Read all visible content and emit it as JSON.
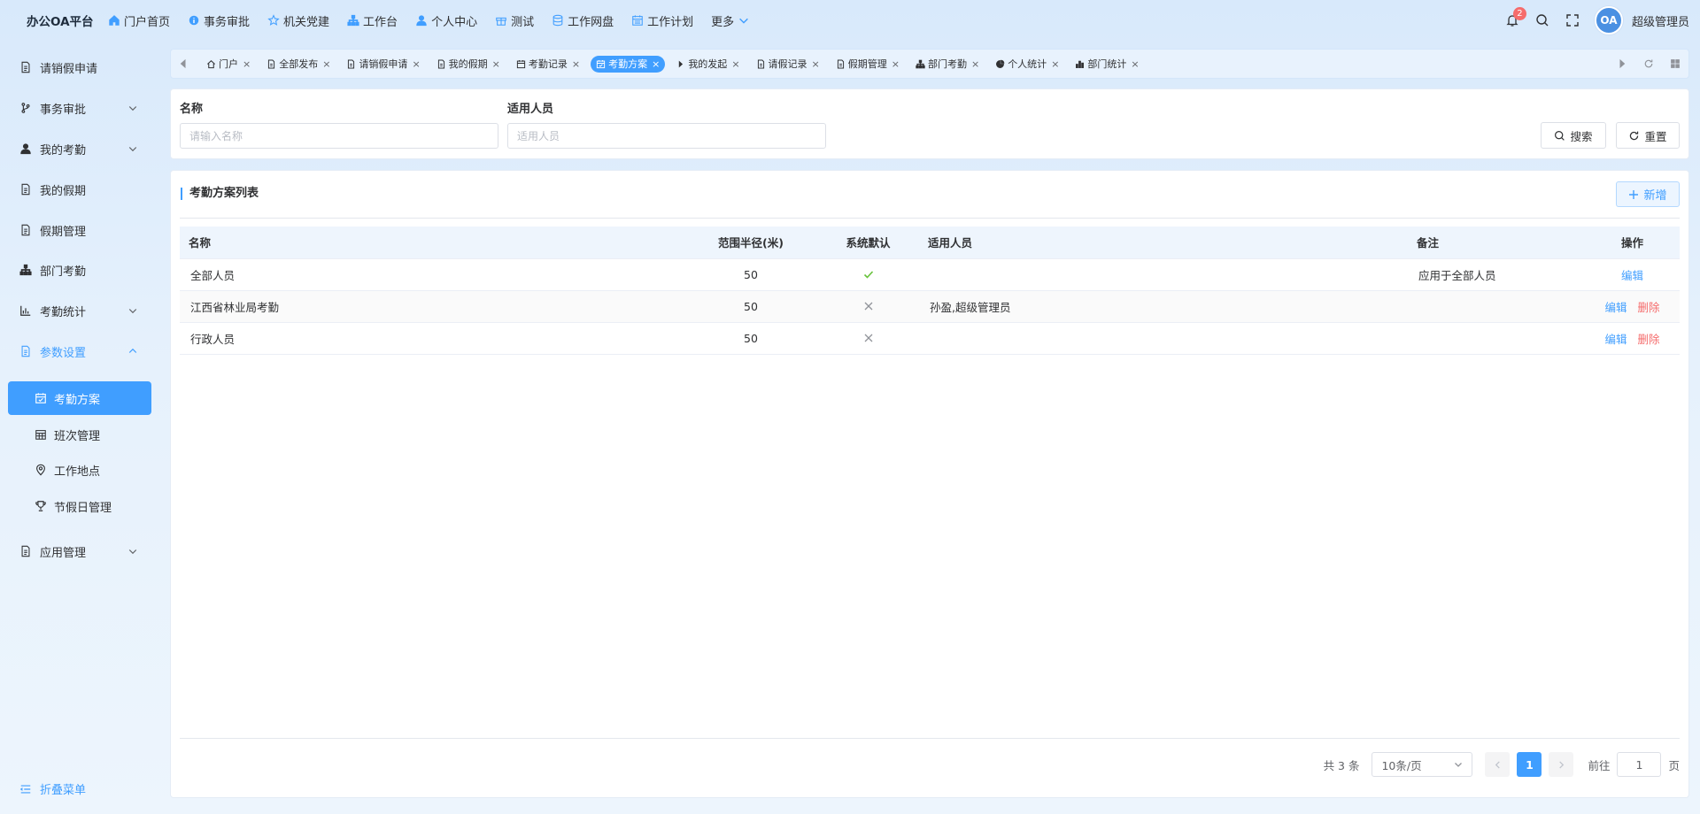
{
  "app": {
    "brand": "办公OA平台"
  },
  "topnav": [
    {
      "label": "门户首页",
      "icon": "home-icon"
    },
    {
      "label": "事务审批",
      "icon": "info-icon"
    },
    {
      "label": "机关党建",
      "icon": "star-icon"
    },
    {
      "label": "工作台",
      "icon": "org-icon"
    },
    {
      "label": "个人中心",
      "icon": "user-icon"
    },
    {
      "label": "测试",
      "icon": "gift-icon"
    },
    {
      "label": "工作网盘",
      "icon": "database-icon"
    },
    {
      "label": "工作计划",
      "icon": "calendar-icon"
    },
    {
      "label": "更多",
      "icon": "chevron-down-icon"
    }
  ],
  "header": {
    "notifications": "2",
    "avatar_text": "OA",
    "username": "超级管理员"
  },
  "sidebar": {
    "items": [
      {
        "label": "请销假申请",
        "icon": "document-icon"
      },
      {
        "label": "事务审批",
        "icon": "branch-icon"
      },
      {
        "label": "我的考勤",
        "icon": "user-icon"
      },
      {
        "label": "我的假期",
        "icon": "document-icon"
      },
      {
        "label": "假期管理",
        "icon": "document-icon"
      },
      {
        "label": "部门考勤",
        "icon": "org-icon"
      },
      {
        "label": "考勤统计",
        "icon": "bar-chart-icon"
      },
      {
        "label": "参数设置",
        "icon": "document-icon"
      },
      {
        "label": "应用管理",
        "icon": "document-icon"
      }
    ],
    "sub_items": [
      {
        "label": "考勤方案",
        "icon": "calendar-check-icon",
        "active": true
      },
      {
        "label": "班次管理",
        "icon": "calendar-grid-icon"
      },
      {
        "label": "工作地点",
        "icon": "location-icon"
      },
      {
        "label": "节假日管理",
        "icon": "trophy-icon"
      }
    ],
    "collapse_label": "折叠菜单"
  },
  "tabs": [
    {
      "label": "门户",
      "icon": "home-icon"
    },
    {
      "label": "全部发布",
      "icon": "document-icon"
    },
    {
      "label": "请销假申请",
      "icon": "document-icon"
    },
    {
      "label": "我的假期",
      "icon": "document-icon"
    },
    {
      "label": "考勤记录",
      "icon": "calendar-icon"
    },
    {
      "label": "考勤方案",
      "icon": "calendar-check-icon",
      "active": true
    },
    {
      "label": "我的发起",
      "icon": "caret-right-icon"
    },
    {
      "label": "请假记录",
      "icon": "document-icon"
    },
    {
      "label": "假期管理",
      "icon": "document-icon"
    },
    {
      "label": "部门考勤",
      "icon": "org-icon"
    },
    {
      "label": "个人统计",
      "icon": "pie-chart-icon"
    },
    {
      "label": "部门统计",
      "icon": "bar-chart-icon"
    }
  ],
  "search": {
    "name_label": "名称",
    "name_placeholder": "请输入名称",
    "people_label": "适用人员",
    "people_placeholder": "适用人员",
    "search_label": "搜索",
    "reset_label": "重置"
  },
  "table": {
    "title": "考勤方案列表",
    "add_label": "新增",
    "columns": [
      "名称",
      "范围半径(米)",
      "系统默认",
      "适用人员",
      "备注",
      "操作"
    ],
    "rows": [
      {
        "name": "全部人员",
        "radius": "50",
        "default": true,
        "people": "",
        "remark": "应用于全部人员",
        "edit": "编辑",
        "delete": ""
      },
      {
        "name": "江西省林业局考勤",
        "radius": "50",
        "default": false,
        "people": "孙盈,超级管理员",
        "remark": "",
        "edit": "编辑",
        "delete": "删除"
      },
      {
        "name": "行政人员",
        "radius": "50",
        "default": false,
        "people": "",
        "remark": "",
        "edit": "编辑",
        "delete": "删除"
      }
    ]
  },
  "pagination": {
    "total_text": "共 3 条",
    "page_size": "10条/页",
    "current_page": "1",
    "goto_prefix": "前往",
    "goto_value": "1",
    "goto_suffix": "页"
  },
  "colors": {
    "primary": "#409eff",
    "danger": "#f56c6c",
    "success": "#67c23a"
  }
}
